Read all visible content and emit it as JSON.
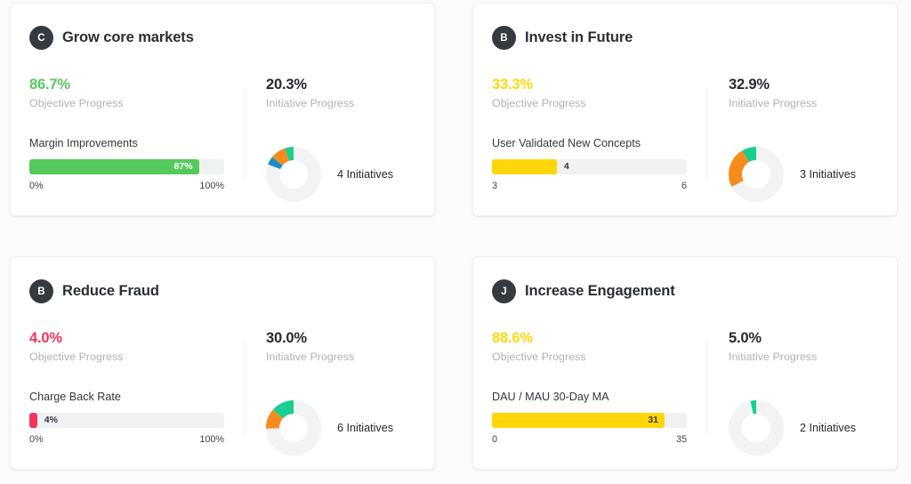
{
  "theme": {
    "page_background": "#fbfbfc",
    "card_background": "#ffffff",
    "avatar_background": "#343a40",
    "green": "#55c95b",
    "yellow": "#ffd60a",
    "crimson": "#f5335b",
    "teal": "#18cf90",
    "orange": "#f78c1e",
    "blue": "#1a8cc8",
    "track_gray": "#f0f1f3",
    "donut_gray": "#f2f3f4"
  },
  "labels": {
    "objective_progress": "Objective Progress",
    "initiative_progress": "Initiative Progress"
  },
  "cards": [
    {
      "avatar": "C",
      "title": "Grow core markets",
      "objective_progress": "86.7%",
      "objective_color": "#55c95b",
      "initiative_progress": "20.3%",
      "kpi": {
        "name": "Margin Improvements",
        "value_label": "87%",
        "fill_percent": 87,
        "fill_color": "#55c95b",
        "label_position": "inside",
        "label_color": "white",
        "scale_min": "0%",
        "scale_max": "100%"
      },
      "donut": {
        "caption": "4 Initiatives",
        "segments": [
          {
            "color": "#18cf90",
            "percent": 5.2
          },
          {
            "color": "#f78c1e",
            "percent": 9.0
          },
          {
            "color": "#1a8cc8",
            "percent": 5.0
          },
          {
            "color": "#f2f3f4",
            "percent": 80.8
          }
        ]
      }
    },
    {
      "avatar": "B",
      "title": "Invest in Future",
      "objective_progress": "33.3%",
      "objective_color": "#ffd60a",
      "initiative_progress": "32.9%",
      "kpi": {
        "name": "User Validated New Concepts",
        "value_label": "4",
        "fill_percent": 33.3,
        "fill_color": "#ffd60a",
        "label_position": "outside",
        "label_color": "dark",
        "scale_min": "3",
        "scale_max": "6"
      },
      "donut": {
        "caption": "3 Initiatives",
        "segments": [
          {
            "color": "#18cf90",
            "percent": 8.5
          },
          {
            "color": "#f78c1e",
            "percent": 24.0
          },
          {
            "color": "#f2f3f4",
            "percent": 67.5
          }
        ]
      }
    },
    {
      "avatar": "B",
      "title": "Reduce Fraud",
      "objective_progress": "4.0%",
      "objective_color": "#f5335b",
      "initiative_progress": "30.0%",
      "kpi": {
        "name": "Charge Back Rate",
        "value_label": "4%",
        "fill_percent": 4,
        "fill_color": "#f5335b",
        "label_position": "outside",
        "label_color": "dark",
        "scale_min": "0%",
        "scale_max": "100%"
      },
      "donut": {
        "caption": "6 Initiatives",
        "segments": [
          {
            "color": "#18cf90",
            "percent": 13.5
          },
          {
            "color": "#f78c1e",
            "percent": 12.0
          },
          {
            "color": "#f2f3f4",
            "percent": 74.5
          }
        ]
      }
    },
    {
      "avatar": "J",
      "title": "Increase Engagement",
      "objective_progress": "88.6%",
      "objective_color": "#ffd60a",
      "initiative_progress": "5.0%",
      "kpi": {
        "name": "DAU / MAU 30-Day MA",
        "value_label": "31",
        "fill_percent": 88.6,
        "fill_color": "#ffd60a",
        "label_position": "inside",
        "label_color": "dark",
        "scale_min": "0",
        "scale_max": "35"
      },
      "donut": {
        "caption": "2 Initiatives",
        "segments": [
          {
            "color": "#18cf90",
            "percent": 3.5
          },
          {
            "color": "#f2f3f4",
            "percent": 96.5
          }
        ]
      }
    }
  ]
}
